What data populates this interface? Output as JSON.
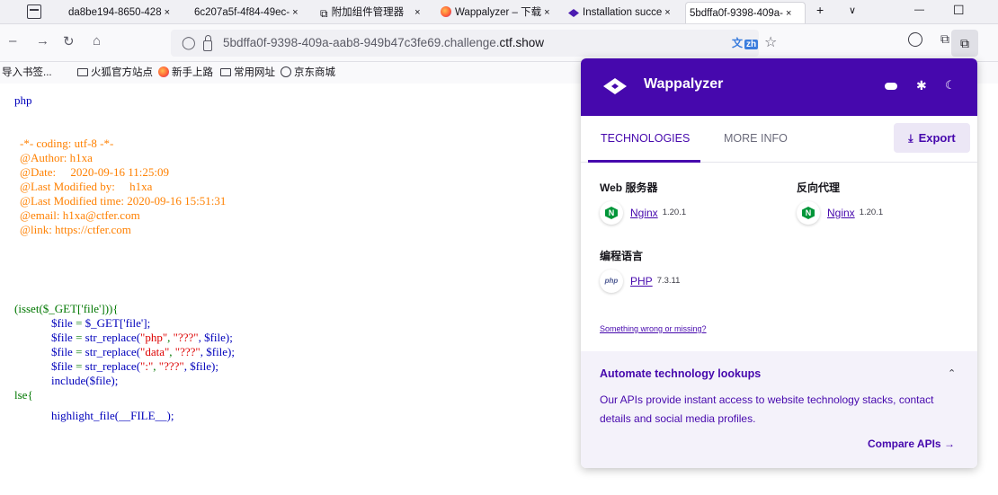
{
  "browser": {
    "tabs": [
      {
        "title": "da8be194-8650-428",
        "close": "×"
      },
      {
        "title": "6c207a5f-4f84-49ec-",
        "close": "×"
      },
      {
        "title": "附加组件管理器",
        "close": "×"
      },
      {
        "title": "Wappalyzer – 下载",
        "close": "×"
      },
      {
        "title": "Installation succe",
        "close": "×"
      },
      {
        "title": "5bdffa0f-9398-409a-",
        "close": "×"
      }
    ],
    "new_tab": "+",
    "tab_list": "∨",
    "minimize": "—",
    "maximize": "☐",
    "url_prefix": "5bdffa0f-9398-409a-aab8-949b47c3fe69.challenge.",
    "url_domain": "ctf.show",
    "translate_label": "文",
    "translate_badge": "zh"
  },
  "bookmarks": [
    "导入书签...",
    "火狐官方站点",
    "新手上路",
    "常用网址",
    "京东商城"
  ],
  "code_lines": {
    "php_tag": "php",
    "coding": "-*- coding: utf-8 -*-",
    "author": "@Author: h1xa",
    "date": "@Date:     2020-09-16 11:25:09",
    "modified_by": "@Last Modified by:     h1xa",
    "modified_time": "@Last Modified time: 2020-09-16 15:51:31",
    "email": "@email: h1xa@ctfer.com",
    "link": "@link: https://ctfer.com",
    "isset": "(isset($_GET['file'])){",
    "l1_var": "$file",
    "l1_op": "=",
    "l1_val": "$_GET['file'];",
    "l2_var": "$file",
    "l2_op": "=",
    "l2_fn": "str_replace(",
    "l2_a1": "\"php\"",
    "l2_c1": ",",
    "l2_a2": "\"???\"",
    "l2_end": ", $file);",
    "l3_var": "$file",
    "l3_op": "=",
    "l3_fn": "str_replace(",
    "l3_a1": "\"data\"",
    "l3_c1": ",",
    "l3_a2": "\"???\"",
    "l3_end": ", $file);",
    "l4_var": "$file",
    "l4_op": "=",
    "l4_fn": "str_replace(",
    "l4_a1": "\":\"",
    "l4_c1": ",",
    "l4_a2": "\"???\"",
    "l4_end": ", $file);",
    "include": "include($file);",
    "else": "lse{",
    "highlight": "highlight_file(__FILE__);"
  },
  "wappalyzer": {
    "brand": "Wappalyzer",
    "tab_technologies": "TECHNOLOGIES",
    "tab_more_info": "MORE INFO",
    "export_label": "Export",
    "categories": [
      {
        "name": "Web 服务器",
        "tech": "Nginx",
        "version": "1.20.1"
      },
      {
        "name": "反向代理",
        "tech": "Nginx",
        "version": "1.20.1"
      },
      {
        "name": "编程语言",
        "tech": "PHP",
        "version": "7.3.11"
      }
    ],
    "wrong_link": "Something wrong or missing?",
    "automate_title": "Automate technology lookups",
    "automate_desc": "Our APIs provide instant access to website technology stacks, contact details and social media profiles.",
    "compare_link": "Compare APIs",
    "colors": {
      "brand": "#4608ad",
      "accent_bg": "#ece7f6"
    }
  }
}
